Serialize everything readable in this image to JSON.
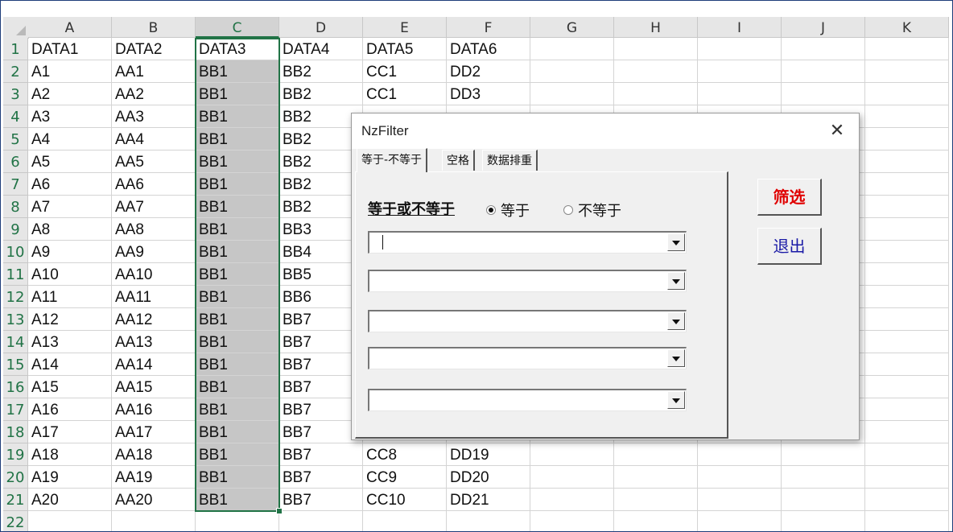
{
  "sheet": {
    "columns": [
      "A",
      "B",
      "C",
      "D",
      "E",
      "F",
      "G",
      "H",
      "I",
      "J",
      "K"
    ],
    "row_numbers": [
      "1",
      "2",
      "3",
      "4",
      "5",
      "6",
      "7",
      "8",
      "9",
      "10",
      "11",
      "12",
      "13",
      "14",
      "15",
      "16",
      "17",
      "18",
      "19",
      "20",
      "21",
      "22"
    ],
    "rows": [
      [
        "DATA1",
        "DATA2",
        "DATA3",
        "DATA4",
        "DATA5",
        "DATA6"
      ],
      [
        "A1",
        "AA1",
        "BB1",
        "BB2",
        "CC1",
        "DD2"
      ],
      [
        "A2",
        "AA2",
        "BB1",
        "BB2",
        "CC1",
        "DD3"
      ],
      [
        "A3",
        "AA3",
        "BB1",
        "BB2",
        "",
        ""
      ],
      [
        "A4",
        "AA4",
        "BB1",
        "BB2",
        "",
        ""
      ],
      [
        "A5",
        "AA5",
        "BB1",
        "BB2",
        "",
        ""
      ],
      [
        "A6",
        "AA6",
        "BB1",
        "BB2",
        "",
        ""
      ],
      [
        "A7",
        "AA7",
        "BB1",
        "BB2",
        "",
        ""
      ],
      [
        "A8",
        "AA8",
        "BB1",
        "BB3",
        "",
        ""
      ],
      [
        "A9",
        "AA9",
        "BB1",
        "BB4",
        "",
        ""
      ],
      [
        "A10",
        "AA10",
        "BB1",
        "BB5",
        "",
        ""
      ],
      [
        "A11",
        "AA11",
        "BB1",
        "BB6",
        "",
        ""
      ],
      [
        "A12",
        "AA12",
        "BB1",
        "BB7",
        "",
        ""
      ],
      [
        "A13",
        "AA13",
        "BB1",
        "BB7",
        "",
        ""
      ],
      [
        "A14",
        "AA14",
        "BB1",
        "BB7",
        "",
        ""
      ],
      [
        "A15",
        "AA15",
        "BB1",
        "BB7",
        "",
        ""
      ],
      [
        "A16",
        "AA16",
        "BB1",
        "BB7",
        "",
        ""
      ],
      [
        "A17",
        "AA17",
        "BB1",
        "BB7",
        "",
        ""
      ],
      [
        "A18",
        "AA18",
        "BB1",
        "BB7",
        "CC8",
        "DD19"
      ],
      [
        "A19",
        "AA19",
        "BB1",
        "BB7",
        "CC9",
        "DD20"
      ],
      [
        "A20",
        "AA20",
        "BB1",
        "BB7",
        "CC10",
        "DD21"
      ],
      [
        "",
        "",
        "",
        "",
        "",
        ""
      ]
    ],
    "selected_column": "C"
  },
  "dialog": {
    "title": "NzFilter",
    "close_symbol": "✕",
    "tabs": [
      {
        "label": "等于-不等于"
      },
      {
        "label": "空格"
      },
      {
        "label": "数据排重"
      }
    ],
    "section_label": "等于或不等于",
    "radio_equal": "等于",
    "radio_not_equal": "不等于",
    "selected_radio": "等于",
    "combo_count": 5,
    "filter_button": "筛选",
    "exit_button": "退出"
  },
  "colors": {
    "excel_green": "#217346",
    "filter_red": "#e00000",
    "exit_blue": "#1a1aa6"
  }
}
